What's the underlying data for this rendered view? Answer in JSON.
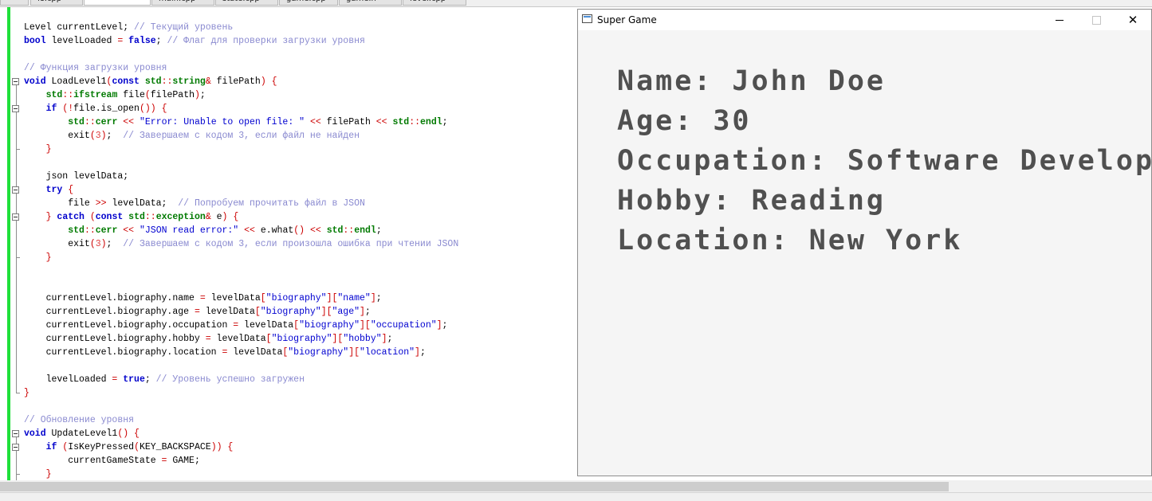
{
  "tabs": [
    "",
    "fs.cpp",
    "",
    "main.cpp",
    "state.cpp",
    "game.cpp",
    "game.h",
    "level.cpp"
  ],
  "editor": {
    "lines": [
      [
        [
          "pl",
          "Level currentLevel; "
        ],
        [
          "cm",
          "// Текущий уровень"
        ]
      ],
      [
        [
          "kw",
          "bool"
        ],
        [
          "pl",
          " levelLoaded "
        ],
        [
          "op",
          "="
        ],
        [
          "pl",
          " "
        ],
        [
          "kw",
          "false"
        ],
        [
          "pl",
          "; "
        ],
        [
          "cm",
          "// Флаг для проверки загрузки уровня"
        ]
      ],
      [
        [
          "pl",
          ""
        ]
      ],
      [
        [
          "cm",
          "// Функция загрузки уровня"
        ]
      ],
      [
        [
          "kw",
          "void"
        ],
        [
          "pl",
          " LoadLevel1"
        ],
        [
          "op",
          "("
        ],
        [
          "kw",
          "const"
        ],
        [
          "pl",
          " "
        ],
        [
          "ty",
          "std"
        ],
        [
          "op",
          "::"
        ],
        [
          "ty",
          "string"
        ],
        [
          "op",
          "&"
        ],
        [
          "pl",
          " filePath"
        ],
        [
          "op",
          ")"
        ],
        [
          "pl",
          " "
        ],
        [
          "op",
          "{"
        ]
      ],
      [
        [
          "pl",
          "    "
        ],
        [
          "ty",
          "std"
        ],
        [
          "op",
          "::"
        ],
        [
          "ty",
          "ifstream"
        ],
        [
          "pl",
          " file"
        ],
        [
          "op",
          "("
        ],
        [
          "pl",
          "filePath"
        ],
        [
          "op",
          ")"
        ],
        [
          "pl",
          ";"
        ]
      ],
      [
        [
          "pl",
          "    "
        ],
        [
          "kw",
          "if"
        ],
        [
          "pl",
          " "
        ],
        [
          "op",
          "(!"
        ],
        [
          "pl",
          "file.is_open"
        ],
        [
          "op",
          "())"
        ],
        [
          "pl",
          " "
        ],
        [
          "op",
          "{"
        ]
      ],
      [
        [
          "pl",
          "        "
        ],
        [
          "ty",
          "std"
        ],
        [
          "op",
          "::"
        ],
        [
          "ty",
          "cerr"
        ],
        [
          "pl",
          " "
        ],
        [
          "op",
          "<<"
        ],
        [
          "pl",
          " "
        ],
        [
          "str",
          "\"Error: Unable to open file: \""
        ],
        [
          "pl",
          " "
        ],
        [
          "op",
          "<<"
        ],
        [
          "pl",
          " filePath "
        ],
        [
          "op",
          "<<"
        ],
        [
          "pl",
          " "
        ],
        [
          "ty",
          "std"
        ],
        [
          "op",
          "::"
        ],
        [
          "ty",
          "endl"
        ],
        [
          "pl",
          ";"
        ]
      ],
      [
        [
          "pl",
          "        exit"
        ],
        [
          "op",
          "("
        ],
        [
          "num",
          "3"
        ],
        [
          "op",
          ")"
        ],
        [
          "pl",
          ";  "
        ],
        [
          "cm",
          "// Завершаем с кодом 3, если файл не найден"
        ]
      ],
      [
        [
          "pl",
          "    "
        ],
        [
          "op",
          "}"
        ]
      ],
      [
        [
          "pl",
          ""
        ]
      ],
      [
        [
          "pl",
          "    json levelData;"
        ]
      ],
      [
        [
          "pl",
          "    "
        ],
        [
          "kw",
          "try"
        ],
        [
          "pl",
          " "
        ],
        [
          "op",
          "{"
        ]
      ],
      [
        [
          "pl",
          "        file "
        ],
        [
          "op",
          ">>"
        ],
        [
          "pl",
          " levelData;  "
        ],
        [
          "cm",
          "// Попробуем прочитать файл в JSON"
        ]
      ],
      [
        [
          "pl",
          "    "
        ],
        [
          "op",
          "}"
        ],
        [
          "pl",
          " "
        ],
        [
          "kw",
          "catch"
        ],
        [
          "pl",
          " "
        ],
        [
          "op",
          "("
        ],
        [
          "kw",
          "const"
        ],
        [
          "pl",
          " "
        ],
        [
          "ty",
          "std"
        ],
        [
          "op",
          "::"
        ],
        [
          "ty",
          "exception"
        ],
        [
          "op",
          "&"
        ],
        [
          "pl",
          " e"
        ],
        [
          "op",
          ")"
        ],
        [
          "pl",
          " "
        ],
        [
          "op",
          "{"
        ]
      ],
      [
        [
          "pl",
          "        "
        ],
        [
          "ty",
          "std"
        ],
        [
          "op",
          "::"
        ],
        [
          "ty",
          "cerr"
        ],
        [
          "pl",
          " "
        ],
        [
          "op",
          "<<"
        ],
        [
          "pl",
          " "
        ],
        [
          "str",
          "\"JSON read error:\""
        ],
        [
          "pl",
          " "
        ],
        [
          "op",
          "<<"
        ],
        [
          "pl",
          " e.what"
        ],
        [
          "op",
          "()"
        ],
        [
          "pl",
          " "
        ],
        [
          "op",
          "<<"
        ],
        [
          "pl",
          " "
        ],
        [
          "ty",
          "std"
        ],
        [
          "op",
          "::"
        ],
        [
          "ty",
          "endl"
        ],
        [
          "pl",
          ";"
        ]
      ],
      [
        [
          "pl",
          "        exit"
        ],
        [
          "op",
          "("
        ],
        [
          "num",
          "3"
        ],
        [
          "op",
          ")"
        ],
        [
          "pl",
          ";  "
        ],
        [
          "cm",
          "// Завершаем с кодом 3, если произошла ошибка при чтении JSON"
        ]
      ],
      [
        [
          "pl",
          "    "
        ],
        [
          "op",
          "}"
        ]
      ],
      [
        [
          "pl",
          ""
        ]
      ],
      [
        [
          "pl",
          ""
        ]
      ],
      [
        [
          "pl",
          "    currentLevel.biography.name "
        ],
        [
          "op",
          "="
        ],
        [
          "pl",
          " levelData"
        ],
        [
          "op",
          "["
        ],
        [
          "str",
          "\"biography\""
        ],
        [
          "op",
          "]["
        ],
        [
          "str",
          "\"name\""
        ],
        [
          "op",
          "]"
        ],
        [
          "pl",
          ";"
        ]
      ],
      [
        [
          "pl",
          "    currentLevel.biography.age "
        ],
        [
          "op",
          "="
        ],
        [
          "pl",
          " levelData"
        ],
        [
          "op",
          "["
        ],
        [
          "str",
          "\"biography\""
        ],
        [
          "op",
          "]["
        ],
        [
          "str",
          "\"age\""
        ],
        [
          "op",
          "]"
        ],
        [
          "pl",
          ";"
        ]
      ],
      [
        [
          "pl",
          "    currentLevel.biography.occupation "
        ],
        [
          "op",
          "="
        ],
        [
          "pl",
          " levelData"
        ],
        [
          "op",
          "["
        ],
        [
          "str",
          "\"biography\""
        ],
        [
          "op",
          "]["
        ],
        [
          "str",
          "\"occupation\""
        ],
        [
          "op",
          "]"
        ],
        [
          "pl",
          ";"
        ]
      ],
      [
        [
          "pl",
          "    currentLevel.biography.hobby "
        ],
        [
          "op",
          "="
        ],
        [
          "pl",
          " levelData"
        ],
        [
          "op",
          "["
        ],
        [
          "str",
          "\"biography\""
        ],
        [
          "op",
          "]["
        ],
        [
          "str",
          "\"hobby\""
        ],
        [
          "op",
          "]"
        ],
        [
          "pl",
          ";"
        ]
      ],
      [
        [
          "pl",
          "    currentLevel.biography.location "
        ],
        [
          "op",
          "="
        ],
        [
          "pl",
          " levelData"
        ],
        [
          "op",
          "["
        ],
        [
          "str",
          "\"biography\""
        ],
        [
          "op",
          "]["
        ],
        [
          "str",
          "\"location\""
        ],
        [
          "op",
          "]"
        ],
        [
          "pl",
          ";"
        ]
      ],
      [
        [
          "pl",
          ""
        ]
      ],
      [
        [
          "pl",
          "    levelLoaded "
        ],
        [
          "op",
          "="
        ],
        [
          "pl",
          " "
        ],
        [
          "kw",
          "true"
        ],
        [
          "pl",
          "; "
        ],
        [
          "cm",
          "// Уровень успешно загружен"
        ]
      ],
      [
        [
          "op",
          "}"
        ]
      ],
      [
        [
          "pl",
          ""
        ]
      ],
      [
        [
          "cm",
          "// Обновление уровня"
        ]
      ],
      [
        [
          "kw",
          "void"
        ],
        [
          "pl",
          " UpdateLevel1"
        ],
        [
          "op",
          "()"
        ],
        [
          "pl",
          " "
        ],
        [
          "op",
          "{"
        ]
      ],
      [
        [
          "pl",
          "    "
        ],
        [
          "kw",
          "if"
        ],
        [
          "pl",
          " "
        ],
        [
          "op",
          "("
        ],
        [
          "pl",
          "IsKeyPressed"
        ],
        [
          "op",
          "("
        ],
        [
          "pl",
          "KEY_BACKSPACE"
        ],
        [
          "op",
          "))"
        ],
        [
          "pl",
          " "
        ],
        [
          "op",
          "{"
        ]
      ],
      [
        [
          "pl",
          "        currentGameState "
        ],
        [
          "op",
          "="
        ],
        [
          "pl",
          " GAME;"
        ]
      ],
      [
        [
          "pl",
          "    "
        ],
        [
          "op",
          "}"
        ]
      ]
    ]
  },
  "game_window": {
    "title": "Super Game",
    "minimize_icon": "minimize-icon",
    "maximize_icon": "maximize-icon",
    "close_label": "✕",
    "lines": [
      "Name: John Doe",
      "Age: 30",
      "Occupation: Software Developer",
      "Hobby: Reading",
      "Location: New York"
    ]
  }
}
